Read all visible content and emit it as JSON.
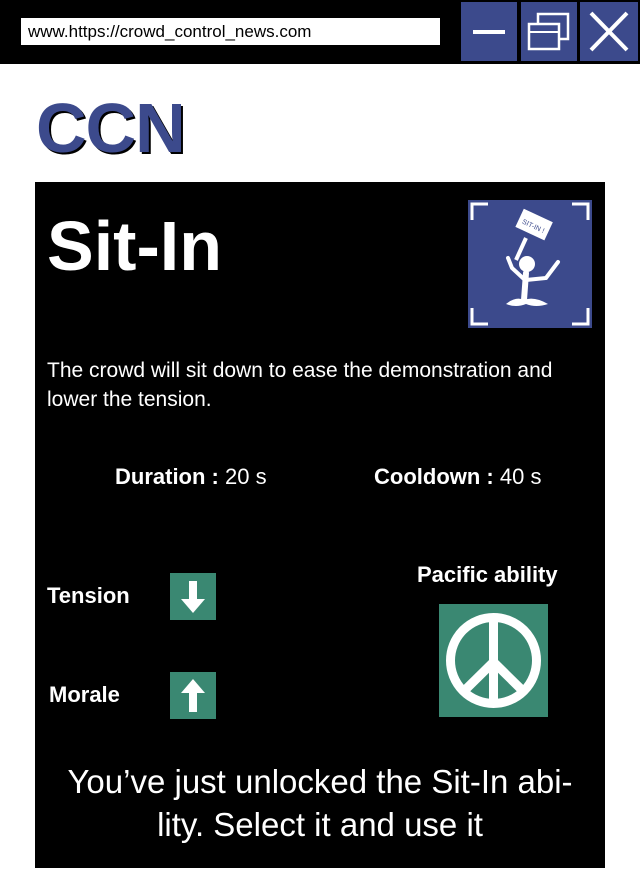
{
  "browser": {
    "url": "www.https://crowd_control_news.com",
    "minimize_icon": "minimize-icon",
    "restore_icon": "restore-icon",
    "close_icon": "close-icon"
  },
  "site": {
    "logo": "CCN"
  },
  "ability": {
    "name": "Sit-In",
    "icon": "sit-in-protester-icon",
    "icon_sign_text": "SIT-IN !",
    "description": "The crowd will sit down to ease the demonstration and lower the tension.",
    "duration_label": "Duration :",
    "duration_value": "20 s",
    "cooldown_label": "Cooldown :",
    "cooldown_value": "40 s",
    "effects": [
      {
        "label": "Tension",
        "direction": "down",
        "icon": "arrow-down-icon"
      },
      {
        "label": "Morale",
        "direction": "up",
        "icon": "arrow-up-icon"
      }
    ],
    "category_label": "Pacific ability",
    "category_icon": "peace-icon",
    "unlock_message_line1": "You’ve just unlocked the Sit-In abi-",
    "unlock_message_line2": "lity. Select it and use it"
  },
  "colors": {
    "brand_blue": "#3c4a8c",
    "effect_green": "#3a8872",
    "panel_bg": "#000000"
  }
}
